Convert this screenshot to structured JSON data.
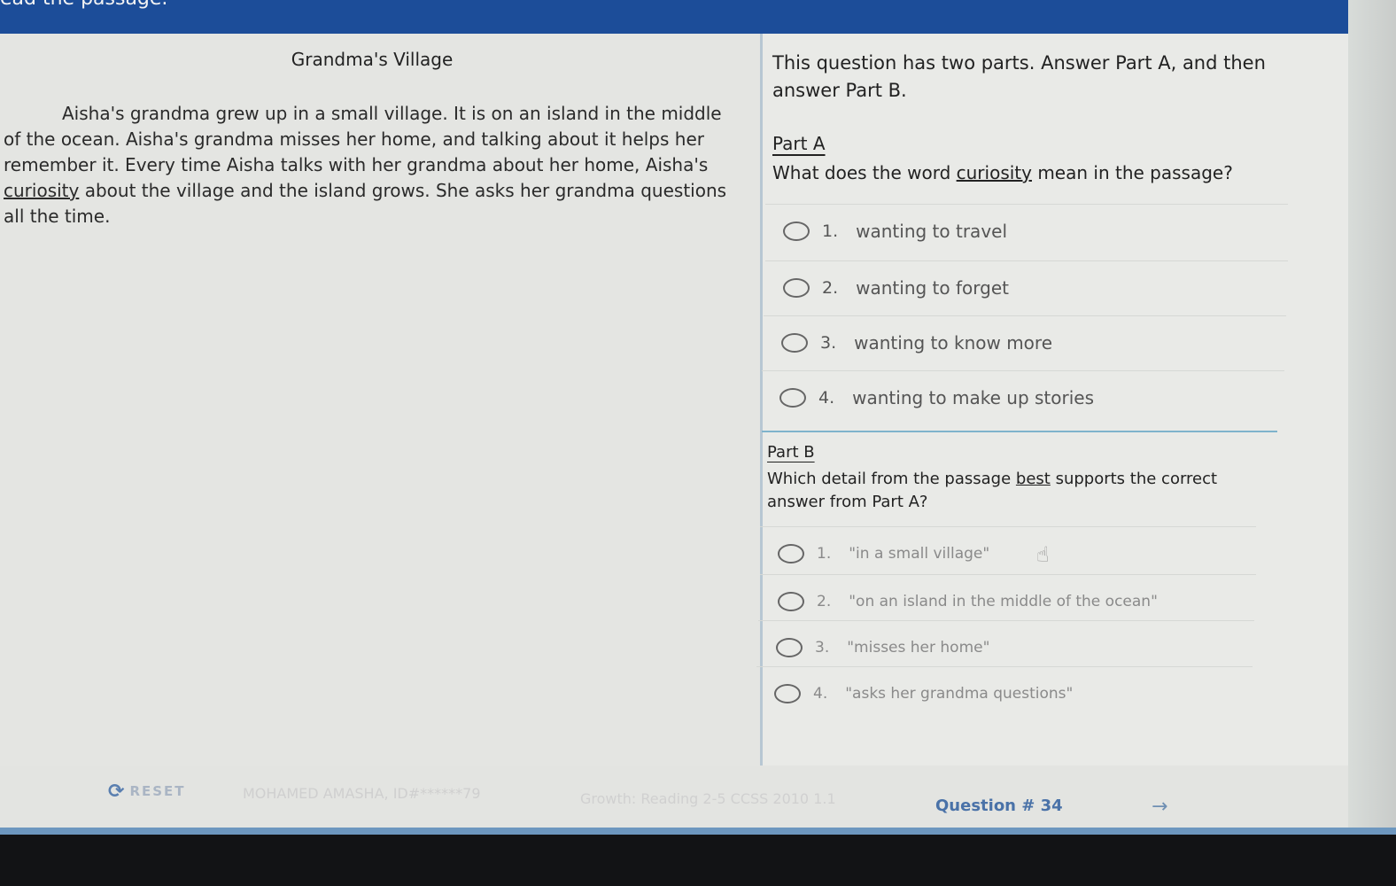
{
  "header": {
    "instruction": "ead the passage."
  },
  "passage": {
    "title": "Grandma's Village",
    "p1": "Aisha's grandma grew up in a small village. It is on an island in the middle of the ocean. Aisha's grandma misses her home, and talking about it helps her remember it. Every time Aisha talks with her grandma about her home, Aisha's",
    "underlined_word": "curiosity",
    "p2": "about the village and the island grows. She asks her grandma questions all the time."
  },
  "question": {
    "intro": "This question has two parts. Answer Part A, and then answer Part B.",
    "partA": {
      "label": "Part A",
      "text_before": "What does the word",
      "underlined_word": "curiosity",
      "text_after": "mean in the passage?",
      "options": [
        {
          "num": "1.",
          "text": "wanting to travel"
        },
        {
          "num": "2.",
          "text": "wanting to forget"
        },
        {
          "num": "3.",
          "text": "wanting to know more"
        },
        {
          "num": "4.",
          "text": "wanting to make up stories"
        }
      ]
    },
    "partB": {
      "label": "Part B",
      "text_before": "Which detail from the passage",
      "underlined_word": "best",
      "text_after": "supports the correct answer from Part A?",
      "options": [
        {
          "num": "1.",
          "text": "\"in a small village\""
        },
        {
          "num": "2.",
          "text": "\"on an island in the middle of the ocean\""
        },
        {
          "num": "3.",
          "text": "\"misses her home\""
        },
        {
          "num": "4.",
          "text": "\"asks her grandma questions\""
        }
      ]
    }
  },
  "footer": {
    "reset_label": "RESET",
    "student": "MOHAMED AMASHA, ID#******79",
    "course": "Growth: Reading 2-5 CCSS 2010 1.1",
    "question_number": "Question # 34"
  },
  "icons": {
    "reset": "refresh-icon",
    "next": "arrow-right-icon",
    "cursor": "hand-pointer-icon"
  },
  "colors": {
    "header_bar": "#1c4d99",
    "accent": "#4a72a8",
    "separator": "#7fb3cc"
  }
}
